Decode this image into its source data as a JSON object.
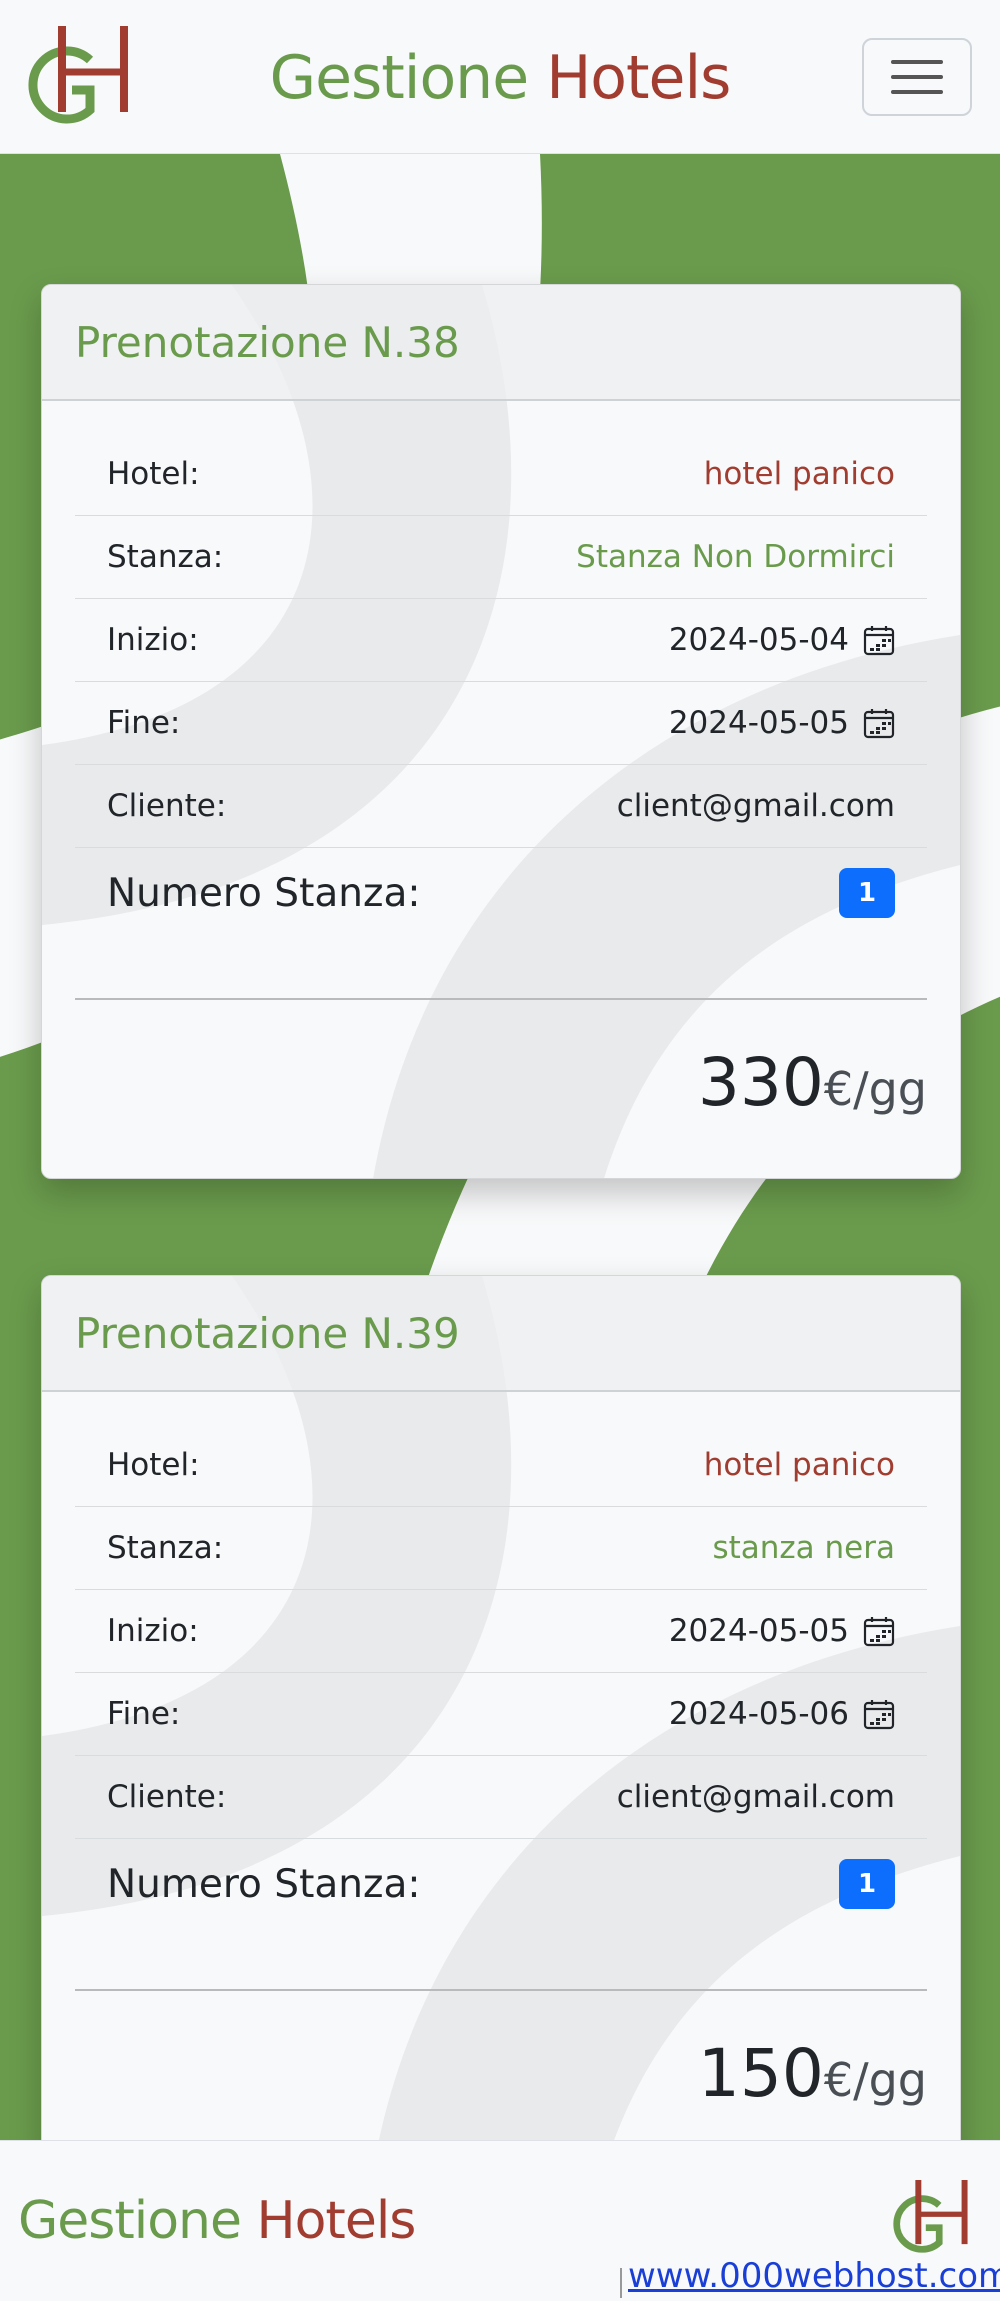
{
  "header": {
    "brand_part1": "Gestione",
    "brand_part2": "Hotels",
    "logo_letters": "GH",
    "menu_icon": "hamburger-icon"
  },
  "bookings": [
    {
      "title": "Prenotazione N.38",
      "hotel_label": "Hotel:",
      "hotel_value": "hotel panico",
      "room_label": "Stanza:",
      "room_value": "Stanza Non Dormirci",
      "start_label": "Inizio:",
      "start_value": "2024-05-04",
      "end_label": "Fine:",
      "end_value": "2024-05-05",
      "client_label": "Cliente:",
      "client_value": "client@gmail.com",
      "rooms_label": "Numero Stanza:",
      "rooms_value": "1",
      "price": "330",
      "price_unit": "€/gg"
    },
    {
      "title": "Prenotazione N.39",
      "hotel_label": "Hotel:",
      "hotel_value": "hotel panico",
      "room_label": "Stanza:",
      "room_value": "stanza nera",
      "start_label": "Inizio:",
      "start_value": "2024-05-05",
      "end_label": "Fine:",
      "end_value": "2024-05-06",
      "client_label": "Cliente:",
      "client_value": "client@gmail.com",
      "rooms_label": "Numero Stanza:",
      "rooms_value": "1",
      "price": "150",
      "price_unit": "€/gg"
    }
  ],
  "footer": {
    "brand_part1": "Gestione",
    "brand_part2": "Hotels",
    "webhost_link": "www.000webhost.com"
  },
  "colors": {
    "brand_green": "#6a9b4c",
    "brand_red": "#a13d30",
    "badge_blue": "#0d6efd"
  }
}
